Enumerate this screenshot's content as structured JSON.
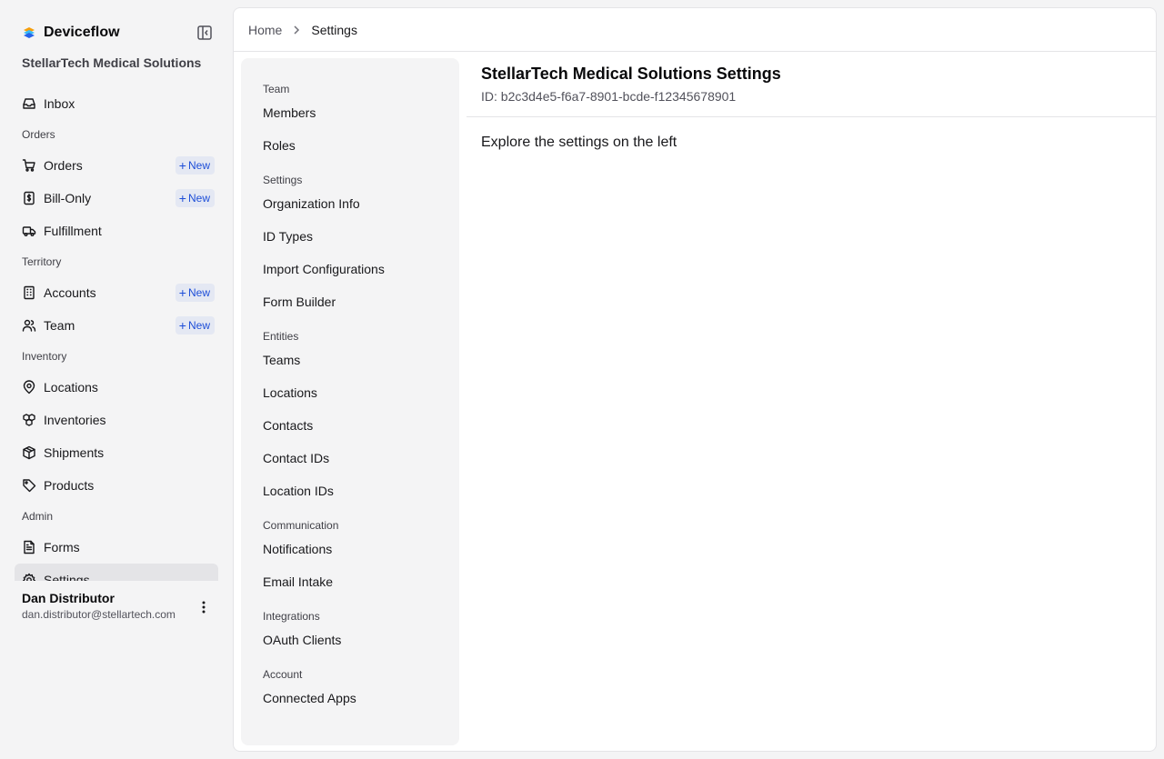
{
  "app": {
    "name": "Deviceflow",
    "org_name": "StellarTech Medical Solutions"
  },
  "sidebar": {
    "new_label": "New",
    "items": [
      {
        "type": "item",
        "label": "Inbox",
        "icon": "inbox-icon"
      },
      {
        "type": "group",
        "label": "Orders"
      },
      {
        "type": "item",
        "label": "Orders",
        "icon": "cart-icon",
        "badge": true
      },
      {
        "type": "item",
        "label": "Bill-Only",
        "icon": "receipt-icon",
        "badge": true
      },
      {
        "type": "item",
        "label": "Fulfillment",
        "icon": "truck-icon"
      },
      {
        "type": "group",
        "label": "Territory"
      },
      {
        "type": "item",
        "label": "Accounts",
        "icon": "building-icon",
        "badge": true
      },
      {
        "type": "item",
        "label": "Team",
        "icon": "users-icon",
        "badge": true
      },
      {
        "type": "group",
        "label": "Inventory"
      },
      {
        "type": "item",
        "label": "Locations",
        "icon": "map-pin-icon"
      },
      {
        "type": "item",
        "label": "Inventories",
        "icon": "boxes-icon"
      },
      {
        "type": "item",
        "label": "Shipments",
        "icon": "package-icon"
      },
      {
        "type": "item",
        "label": "Products",
        "icon": "tag-icon"
      },
      {
        "type": "group",
        "label": "Admin"
      },
      {
        "type": "item",
        "label": "Forms",
        "icon": "file-text-icon"
      },
      {
        "type": "item",
        "label": "Settings",
        "icon": "gear-icon",
        "active": true
      }
    ]
  },
  "user": {
    "name": "Dan Distributor",
    "email": "dan.distributor@stellartech.com"
  },
  "breadcrumb": {
    "home": "Home",
    "current": "Settings"
  },
  "settings_nav": [
    {
      "type": "group",
      "label": "Team"
    },
    {
      "type": "item",
      "label": "Members"
    },
    {
      "type": "item",
      "label": "Roles"
    },
    {
      "type": "group",
      "label": "Settings"
    },
    {
      "type": "item",
      "label": "Organization Info"
    },
    {
      "type": "item",
      "label": "ID Types"
    },
    {
      "type": "item",
      "label": "Import Configurations"
    },
    {
      "type": "item",
      "label": "Form Builder"
    },
    {
      "type": "group",
      "label": "Entities"
    },
    {
      "type": "item",
      "label": "Teams"
    },
    {
      "type": "item",
      "label": "Locations"
    },
    {
      "type": "item",
      "label": "Contacts"
    },
    {
      "type": "item",
      "label": "Contact IDs"
    },
    {
      "type": "item",
      "label": "Location IDs"
    },
    {
      "type": "group",
      "label": "Communication"
    },
    {
      "type": "item",
      "label": "Notifications"
    },
    {
      "type": "item",
      "label": "Email Intake"
    },
    {
      "type": "group",
      "label": "Integrations"
    },
    {
      "type": "item",
      "label": "OAuth Clients"
    },
    {
      "type": "group",
      "label": "Account"
    },
    {
      "type": "item",
      "label": "Connected Apps"
    }
  ],
  "content": {
    "title": "StellarTech Medical Solutions Settings",
    "id_text": "ID: b2c3d4e5-f6a7-8901-bcde-f12345678901",
    "hint": "Explore the settings on the left"
  },
  "colors": {
    "accent": "#1d4ed8",
    "badge_bg": "#e4e8f3",
    "sidebar_bg": "#f4f4f5",
    "active_bg": "#e4e4e7"
  }
}
